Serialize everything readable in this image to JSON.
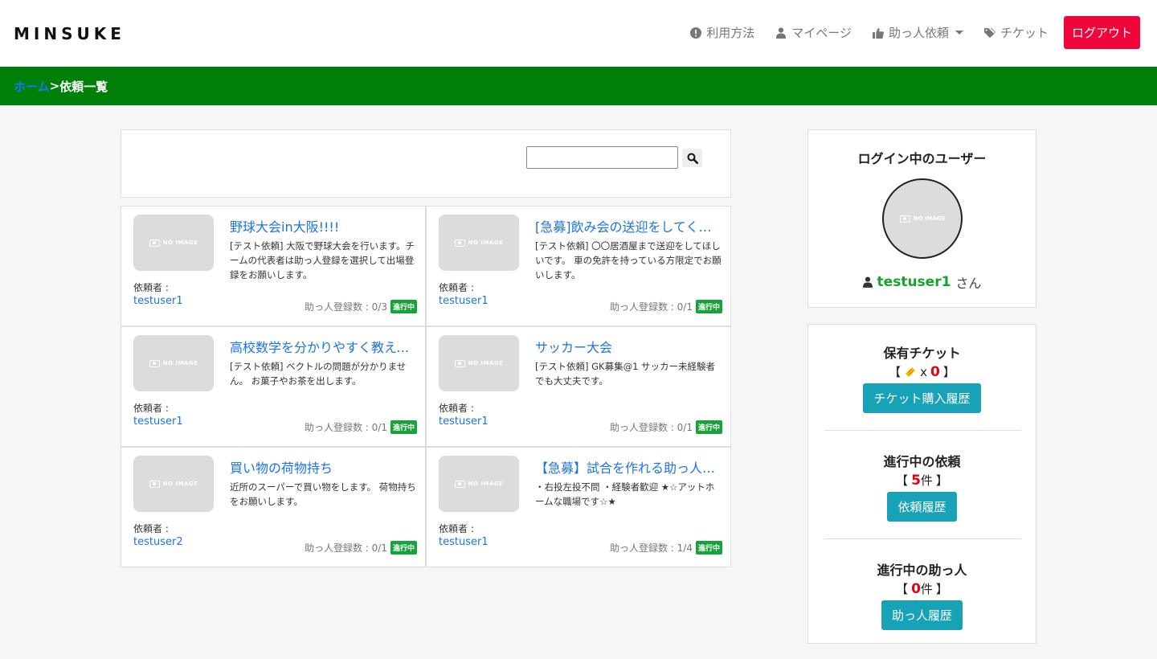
{
  "header": {
    "logo": "MINSUKE",
    "nav": {
      "usage": "利用方法",
      "mypage": "マイページ",
      "requests": "助っ人依頼",
      "ticket": "チケット",
      "logout": "ログアウト"
    }
  },
  "breadcrumb": {
    "home": "ホーム",
    "separator": ">",
    "current": "依頼一覧"
  },
  "search": {
    "value": ""
  },
  "cards": [
    {
      "title": "野球大会in大阪!!!!",
      "desc": "[テスト依頼] 大阪で野球大会を行います。チームの代表者は助っ人登録を選択して出場登録をお願いします。",
      "requester_label": "依頼者 :",
      "requester": "testuser1",
      "count": "助っ人登録数 : 0/3",
      "status": "進行中",
      "thumb": "NO IMAGE"
    },
    {
      "title": "[急募]飲み会の送迎をしてください",
      "desc": "[テスト依頼] 〇〇居酒屋まで送迎をしてほしいです。 車の免許を持っている方限定でお願いします。",
      "requester_label": "依頼者 :",
      "requester": "testuser1",
      "count": "助っ人登録数 : 0/1",
      "status": "進行中",
      "thumb": "NO IMAGE"
    },
    {
      "title": "高校数学を分かりやすく教えてください",
      "desc": "[テスト依頼] ベクトルの問題が分かりません。 お菓子やお茶を出します。",
      "requester_label": "依頼者 :",
      "requester": "testuser1",
      "count": "助っ人登録数 : 0/1",
      "status": "進行中",
      "thumb": "NO IMAGE"
    },
    {
      "title": "サッカー大会",
      "desc": "[テスト依頼] GK募集@1 サッカー未経験者でも大丈夫です。",
      "requester_label": "依頼者 :",
      "requester": "testuser1",
      "count": "助っ人登録数 : 0/1",
      "status": "進行中",
      "thumb": "NO IMAGE"
    },
    {
      "title": "買い物の荷物持ち",
      "desc": "近所のスーパーで買い物をします。 荷物持ちをお願いします。",
      "requester_label": "依頼者 :",
      "requester": "testuser2",
      "count": "助っ人登録数 : 0/1",
      "status": "進行中",
      "thumb": "NO IMAGE"
    },
    {
      "title": "【急募】試合を作れる助っ人募集",
      "desc": "・右投左投不問 ・経験者歓迎 ★☆アットホームな職場です☆★",
      "requester_label": "依頼者 :",
      "requester": "testuser1",
      "count": "助っ人登録数 : 1/4",
      "status": "進行中",
      "thumb": "NO IMAGE"
    }
  ],
  "sidebar": {
    "login_title": "ログイン中のユーザー",
    "avatar_text": "NO IMAGE",
    "username": "testuser1",
    "honorific": "さん",
    "tickets": {
      "label": "保有チケット",
      "open": "【",
      "times": "x",
      "value": "0",
      "close": "】",
      "button": "チケット購入履歴"
    },
    "requests": {
      "label": "進行中の依頼",
      "open": "【",
      "value": "5",
      "unit": "件",
      "close": "】",
      "button": "依頼履歴"
    },
    "helpers": {
      "label": "進行中の助っ人",
      "open": "【",
      "value": "0",
      "unit": "件",
      "close": "】",
      "button": "助っ人履歴"
    }
  },
  "colors": {
    "breadcrumb_bg": "#008008",
    "logout_bg": "#f0053a",
    "button_bg": "#17a2b8",
    "status_bg": "#16a339",
    "link": "#1a73e8",
    "username": "#16a32a",
    "count_red": "#e60012"
  }
}
